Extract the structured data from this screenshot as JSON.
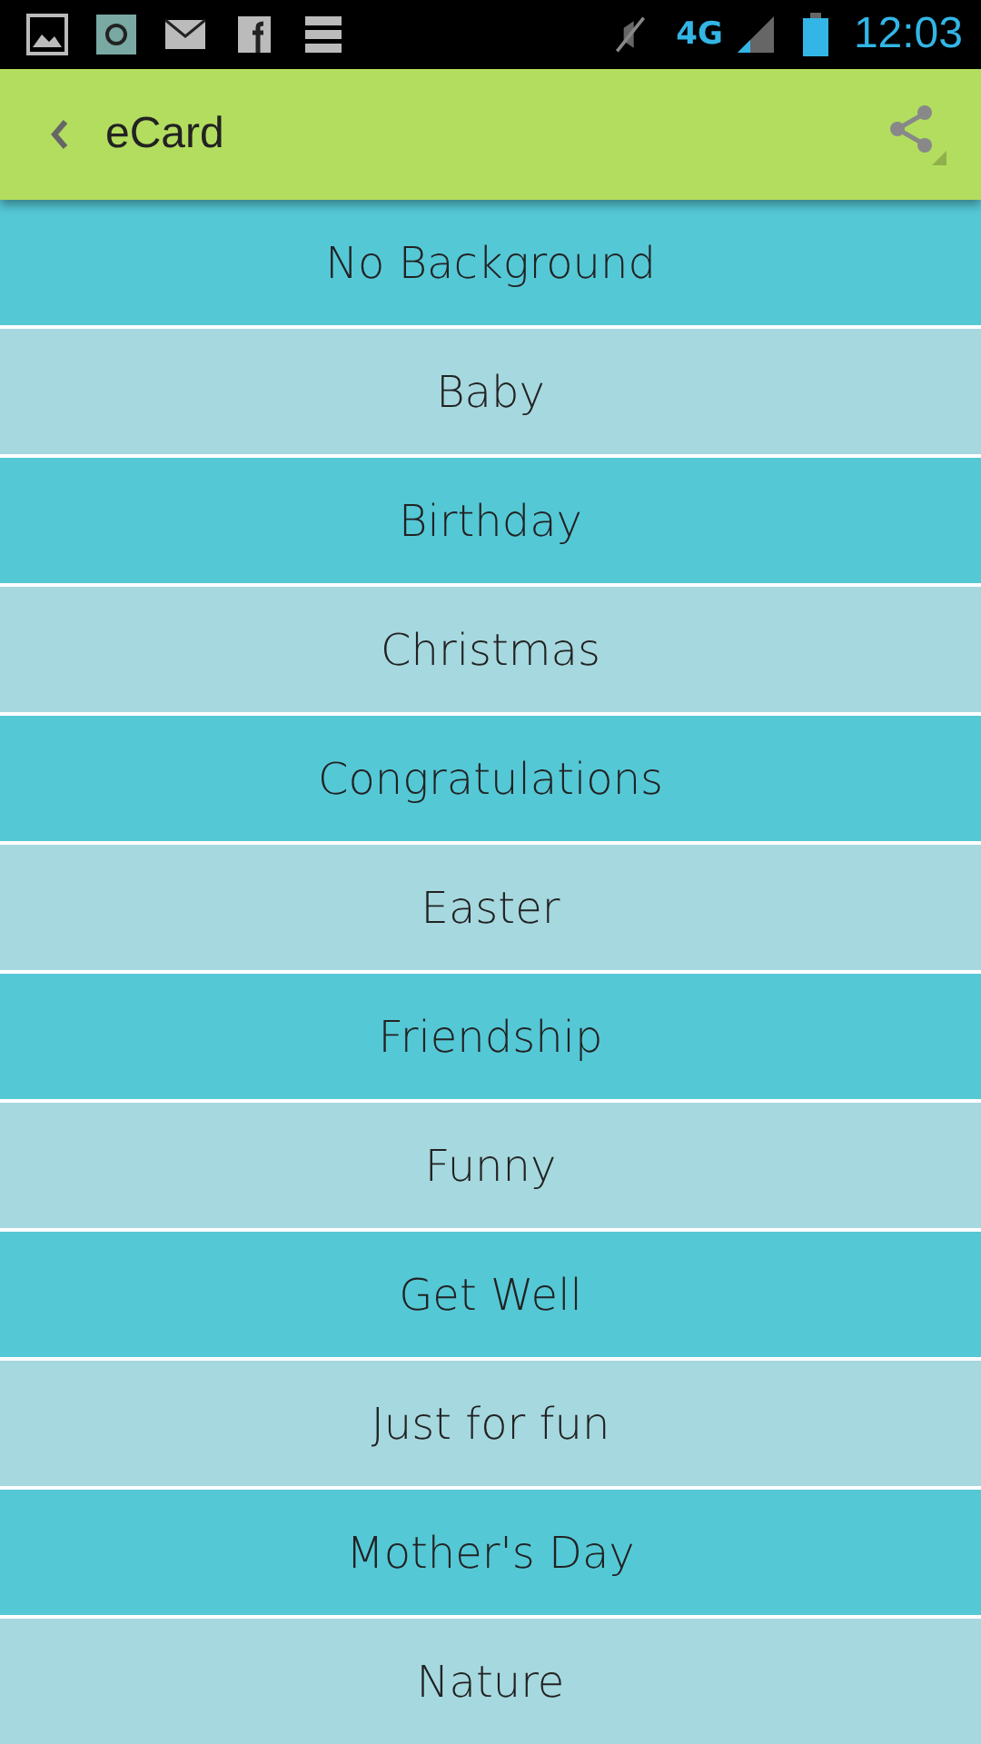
{
  "status_bar": {
    "network": "4G",
    "time": "12:03"
  },
  "app_bar": {
    "title": "eCard"
  },
  "items": [
    {
      "label": "No Background"
    },
    {
      "label": "Baby"
    },
    {
      "label": "Birthday"
    },
    {
      "label": "Christmas"
    },
    {
      "label": "Congratulations"
    },
    {
      "label": "Easter"
    },
    {
      "label": "Friendship"
    },
    {
      "label": "Funny"
    },
    {
      "label": "Get Well"
    },
    {
      "label": "Just for fun"
    },
    {
      "label": "Mother's Day"
    },
    {
      "label": "Nature"
    }
  ]
}
